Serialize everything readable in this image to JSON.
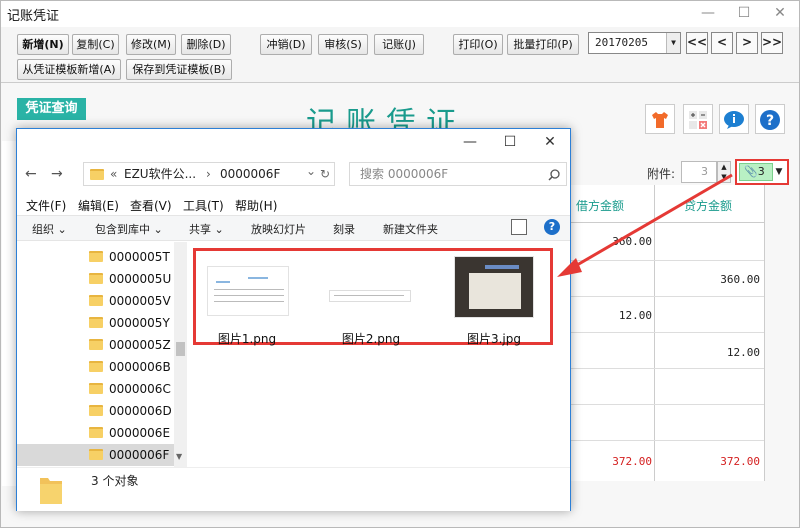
{
  "app": {
    "title": "记账凭证",
    "win_min": "—",
    "win_max": "☐",
    "win_close": "✕"
  },
  "toolbar": {
    "new": "新增(N)",
    "copy": "复制(C)",
    "modify": "修改(M)",
    "delete": "删除(D)",
    "reverse": "冲销(D)",
    "audit": "审核(S)",
    "post": "记账(J)",
    "print": "打印(O)",
    "batch_print": "批量打印(P)",
    "from_template": "从凭证模板新增(A)",
    "save_template": "保存到凭证模板(B)",
    "date": "20170205",
    "nav_first": "<<",
    "nav_prev": "<",
    "nav_next": ">",
    "nav_last": ">>"
  },
  "main": {
    "query": "凭证查询",
    "voucher_title": "记账凭证",
    "attach_label": "附件:",
    "attach_count": "3",
    "attach_files": "3",
    "debit_header": "借方金额",
    "credit_header": "贷方金额",
    "rows": [
      {
        "debit": "360.00",
        "credit": ""
      },
      {
        "debit": "",
        "credit": "360.00"
      },
      {
        "debit": "12.00",
        "credit": ""
      },
      {
        "debit": "",
        "credit": "12.00"
      }
    ],
    "total_debit": "372.00",
    "total_credit": "372.00",
    "accent": "#1a9b8d",
    "highlight": "#e53935"
  },
  "explorer": {
    "back": "←",
    "forward": "→",
    "breadcrumb_prefix": "«",
    "breadcrumb_parent": "EZU软件公...",
    "breadcrumb_sep": "›",
    "breadcrumb_current": "0000006F",
    "address_dropdown": "⌄",
    "refresh": "↻",
    "search_placeholder": "搜索 0000006F",
    "menus": [
      "文件(F)",
      "编辑(E)",
      "查看(V)",
      "工具(T)",
      "帮助(H)"
    ],
    "commands": [
      "组织 ⌄",
      "包含到库中 ⌄",
      "共享 ⌄",
      "放映幻灯片",
      "刻录",
      "新建文件夹"
    ],
    "folders": [
      "0000005T",
      "0000005U",
      "0000005V",
      "0000005Y",
      "0000005Z",
      "0000006B",
      "0000006C",
      "0000006D",
      "0000006E",
      "0000006F"
    ],
    "files": [
      "图片1.png",
      "图片2.png",
      "图片3.jpg"
    ],
    "status": "3 个对象"
  }
}
